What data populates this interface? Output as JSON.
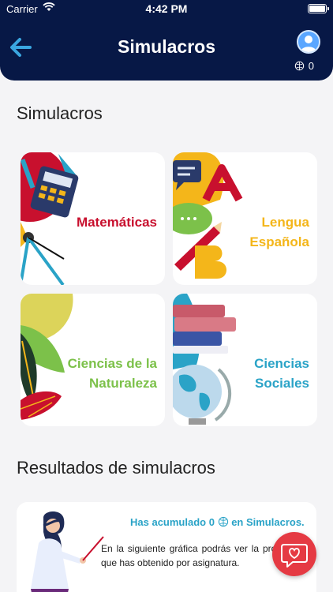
{
  "status_bar": {
    "carrier": "Carrier",
    "time": "4:42 PM"
  },
  "header": {
    "title": "Simulacros",
    "points": "0"
  },
  "sections": {
    "simulacros_title": "Simulacros",
    "results_title": "Resultados de simulacros"
  },
  "subjects": [
    {
      "label_line1": "Matemáticas",
      "label_line2": "",
      "color": "#c8102e"
    },
    {
      "label_line1": "Lengua",
      "label_line2": "Española",
      "color": "#f4b61a"
    },
    {
      "label_line1": "Ciencias de la",
      "label_line2": "Naturaleza",
      "color": "#7cc14a"
    },
    {
      "label_line1": "Ciencias",
      "label_line2": "Sociales",
      "color": "#2aa3c7"
    }
  ],
  "results": {
    "headline_prefix": "Has acumulado 0",
    "headline_suffix": "en Simulacros.",
    "body": "En la siguiente gráfica podrás ver la promedio que has obtenido por asignatura."
  },
  "colors": {
    "navy": "#071846",
    "accent_blue": "#2aa3c7",
    "fab_red": "#e53a43"
  },
  "icons": [
    "back-arrow-icon",
    "avatar-icon",
    "brain-icon",
    "heart-chat-icon",
    "wifi-icon",
    "battery-icon"
  ]
}
